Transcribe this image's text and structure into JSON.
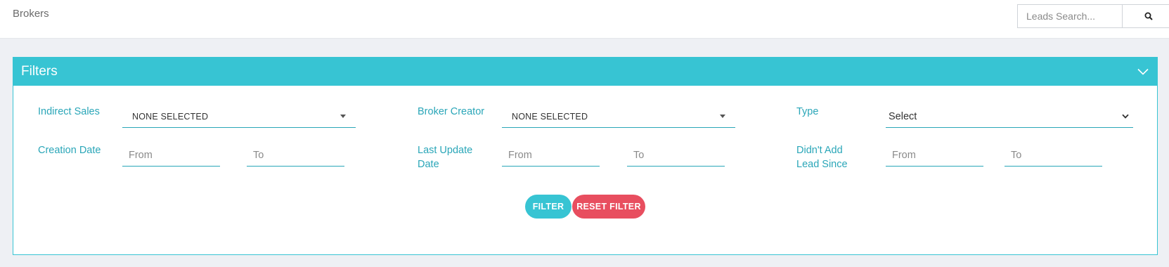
{
  "header": {
    "title": "Brokers",
    "search": {
      "placeholder": "Leads Search...",
      "icon": "search-icon"
    }
  },
  "filters": {
    "title": "Filters",
    "collapse_icon": "chevron-down-icon",
    "indirect_sales": {
      "label": "Indirect Sales",
      "value": "NONE SELECTED"
    },
    "broker_creator": {
      "label": "Broker Creator",
      "value": "NONE SELECTED"
    },
    "type": {
      "label": "Type",
      "value": "Select"
    },
    "creation_date": {
      "label": "Creation Date",
      "from_placeholder": "From",
      "to_placeholder": "To"
    },
    "last_update_date": {
      "label_line1": "Last Update",
      "label_line2": "Date",
      "from_placeholder": "From",
      "to_placeholder": "To"
    },
    "didnt_add_lead_since": {
      "label_line1": "Didn't Add",
      "label_line2": "Lead Since",
      "from_placeholder": "From",
      "to_placeholder": "To"
    },
    "filter_button": "FILTER",
    "reset_button": "RESET FILTER"
  },
  "colors": {
    "accent": "#37c4d3",
    "label": "#2aa6b8",
    "danger": "#e84e5f",
    "background": "#eef0f4"
  }
}
